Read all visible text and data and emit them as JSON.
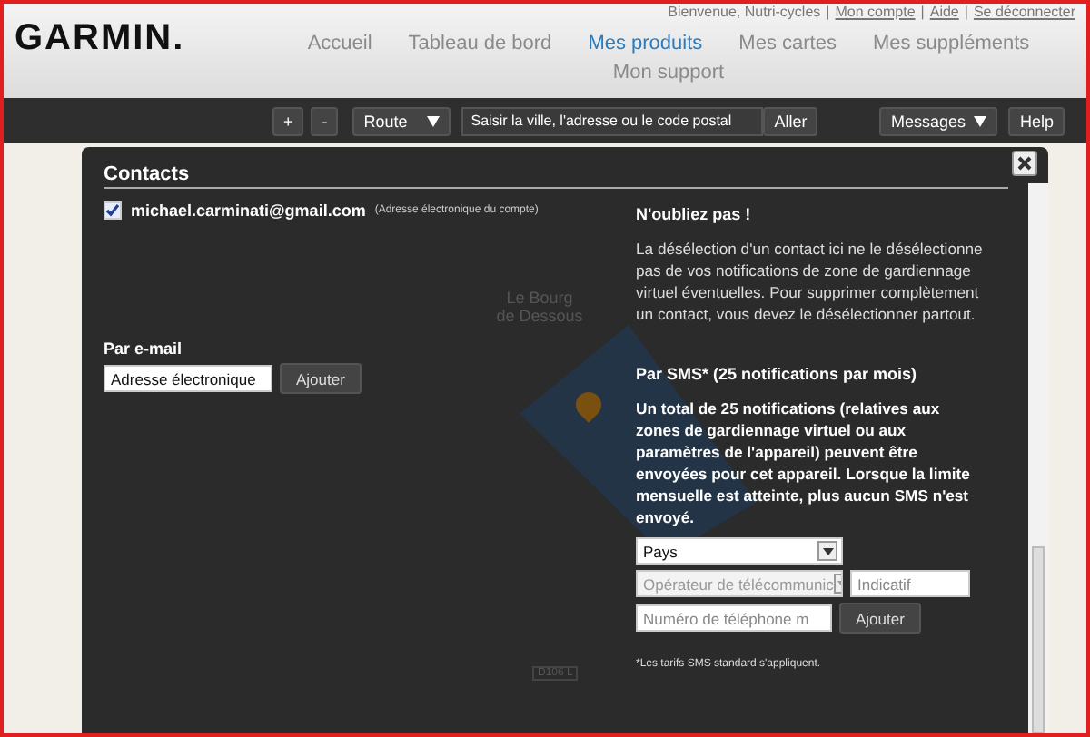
{
  "header": {
    "logo": "GARMIN.",
    "user_links": [
      "Bienvenue, Nutri-cycles",
      "Mon compte",
      "Aide",
      "Se déconnecter"
    ],
    "user_links_separator": "|",
    "nav": [
      {
        "label": "Accueil",
        "selected": false
      },
      {
        "label": "Tableau de bord",
        "selected": false
      },
      {
        "label": "Mes produits",
        "selected": true
      },
      {
        "label": "Mes cartes",
        "selected": false
      },
      {
        "label": "Mes suppléments",
        "selected": false
      },
      {
        "label": "Mon support",
        "selected": false
      }
    ]
  },
  "toolbar": {
    "zoom_in": "+",
    "zoom_out": "-",
    "map_type": "Route",
    "search_placeholder": "Saisir la ville, l'adresse ou le code postal",
    "go": "Aller",
    "messages": "Messages",
    "help": "Help"
  },
  "map_labels": [
    "Le Bourg de Dessous",
    "D106 L"
  ],
  "dialog": {
    "title": "Contacts",
    "contacts": [
      {
        "email": "michael.carminati@gmail.com",
        "note": "(Adresse électronique du compte)",
        "checked": true
      }
    ],
    "email_section": {
      "title": "Par e-mail",
      "value": "Adresse électronique",
      "add": "Ajouter"
    },
    "reminder": {
      "title": "N'oubliez pas !",
      "text": "La désélection d'un contact ici ne le désélectionne pas de vos notifications de zone de gardiennage virtuel éventuelles. Pour supprimer complètement un contact, vous devez le désélectionner partout."
    },
    "sms_section": {
      "title": "Par SMS* (25 notifications par mois)",
      "text": "Un total de 25 notifications (relatives aux zones de gardiennage virtuel ou aux paramètres de l'appareil) peuvent être envoyées pour cet appareil. Lorsque la limite mensuelle est atteinte, plus aucun SMS n'est envoyé.",
      "country": "Pays",
      "carrier_placeholder": "Opérateur de télécommunic",
      "code_placeholder": "Indicatif",
      "phone_placeholder": "Numéro de téléphone m",
      "add": "Ajouter",
      "footnote": "*Les tarifs SMS standard s'appliquent."
    }
  }
}
